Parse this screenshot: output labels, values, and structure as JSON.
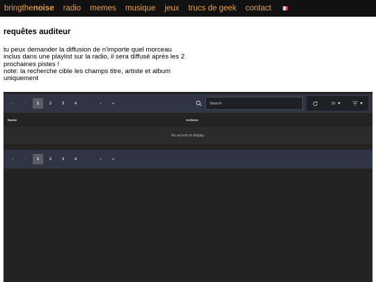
{
  "nav": {
    "brand_prefix": "bringthe",
    "brand_bold": "noise",
    "links": [
      "radio",
      "memes",
      "musique",
      "jeux",
      "trucs de geek",
      "contact"
    ],
    "flag_colors": [
      "#0055a4",
      "#ffffff",
      "#ef4135"
    ]
  },
  "page": {
    "title": "requêtes auditeur",
    "description": "tu peux demander la diffusion de n'importe quel morceau inclus dans une playlist sur la radio, il sera diffusé après les 2 prochaines pistes !",
    "note": "note: la recherche cible les champs titre, artiste et album uniquement"
  },
  "table": {
    "pagination_top": {
      "first": "«",
      "prev": "‹",
      "pages": [
        "1",
        "2",
        "3",
        "4"
      ],
      "ellipsis": "…",
      "next": "›",
      "last": "»",
      "active_page": "1"
    },
    "search_placeholder": "Search",
    "page_size": "10",
    "columns": [
      "Name",
      "Actions"
    ],
    "empty_message": "No records to display."
  },
  "colors": {
    "nav_link": "#e8a13a",
    "panel_bg": "#232323",
    "bar_bg": "#313442"
  }
}
